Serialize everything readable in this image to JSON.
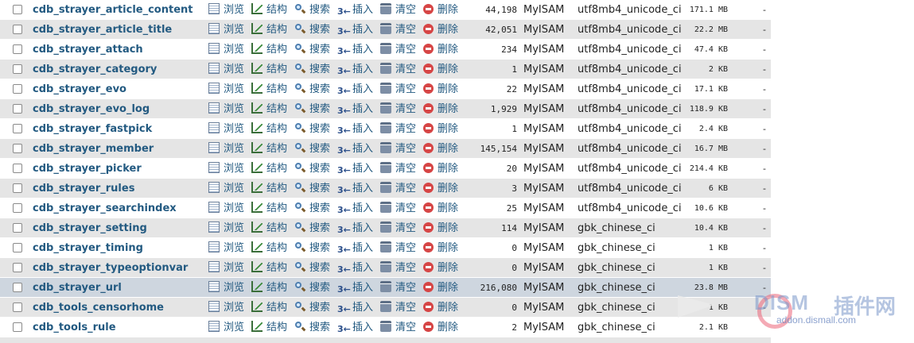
{
  "actions": {
    "browse": "浏览",
    "structure": "结构",
    "search": "搜索",
    "insert": "插入",
    "empty": "清空",
    "drop": "删除"
  },
  "overhead_default": "-",
  "tables": [
    {
      "name": "cdb_strayer_article_content",
      "rows": "44,198",
      "engine": "MyISAM",
      "collation": "utf8mb4_unicode_ci",
      "size": "171.1 MB",
      "overhead": "-"
    },
    {
      "name": "cdb_strayer_article_title",
      "rows": "42,051",
      "engine": "MyISAM",
      "collation": "utf8mb4_unicode_ci",
      "size": "22.2 MB",
      "overhead": "-"
    },
    {
      "name": "cdb_strayer_attach",
      "rows": "234",
      "engine": "MyISAM",
      "collation": "utf8mb4_unicode_ci",
      "size": "47.4 KB",
      "overhead": "-"
    },
    {
      "name": "cdb_strayer_category",
      "rows": "1",
      "engine": "MyISAM",
      "collation": "utf8mb4_unicode_ci",
      "size": "2 KB",
      "overhead": "-"
    },
    {
      "name": "cdb_strayer_evo",
      "rows": "22",
      "engine": "MyISAM",
      "collation": "utf8mb4_unicode_ci",
      "size": "17.1 KB",
      "overhead": "-"
    },
    {
      "name": "cdb_strayer_evo_log",
      "rows": "1,929",
      "engine": "MyISAM",
      "collation": "utf8mb4_unicode_ci",
      "size": "118.9 KB",
      "overhead": "-"
    },
    {
      "name": "cdb_strayer_fastpick",
      "rows": "1",
      "engine": "MyISAM",
      "collation": "utf8mb4_unicode_ci",
      "size": "2.4 KB",
      "overhead": "-"
    },
    {
      "name": "cdb_strayer_member",
      "rows": "145,154",
      "engine": "MyISAM",
      "collation": "utf8mb4_unicode_ci",
      "size": "16.7 MB",
      "overhead": "-"
    },
    {
      "name": "cdb_strayer_picker",
      "rows": "20",
      "engine": "MyISAM",
      "collation": "utf8mb4_unicode_ci",
      "size": "214.4 KB",
      "overhead": "-"
    },
    {
      "name": "cdb_strayer_rules",
      "rows": "3",
      "engine": "MyISAM",
      "collation": "utf8mb4_unicode_ci",
      "size": "6 KB",
      "overhead": "-"
    },
    {
      "name": "cdb_strayer_searchindex",
      "rows": "25",
      "engine": "MyISAM",
      "collation": "utf8mb4_unicode_ci",
      "size": "10.6 KB",
      "overhead": "-"
    },
    {
      "name": "cdb_strayer_setting",
      "rows": "114",
      "engine": "MyISAM",
      "collation": "gbk_chinese_ci",
      "size": "10.4 KB",
      "overhead": "-"
    },
    {
      "name": "cdb_strayer_timing",
      "rows": "0",
      "engine": "MyISAM",
      "collation": "gbk_chinese_ci",
      "size": "1 KB",
      "overhead": "-"
    },
    {
      "name": "cdb_strayer_typeoptionvar",
      "rows": "0",
      "engine": "MyISAM",
      "collation": "gbk_chinese_ci",
      "size": "1 KB",
      "overhead": "-"
    },
    {
      "name": "cdb_strayer_url",
      "rows": "216,080",
      "engine": "MyISAM",
      "collation": "gbk_chinese_ci",
      "size": "23.8 MB",
      "overhead": "-",
      "highlighted": true
    },
    {
      "name": "cdb_tools_censorhome",
      "rows": "0",
      "engine": "MyISAM",
      "collation": "gbk_chinese_ci",
      "size": "1 KB",
      "overhead": "-"
    },
    {
      "name": "cdb_tools_rule",
      "rows": "2",
      "engine": "MyISAM",
      "collation": "gbk_chinese_ci",
      "size": "2.1 KB",
      "overhead": ""
    }
  ],
  "watermark": {
    "logo": "DISM",
    "zh": "插件网",
    "url": "addon.dismall.com"
  },
  "colors": {
    "row_even": "#ffffff",
    "row_odd": "#e5e5e5",
    "row_highlight": "#ced6df",
    "link": "#235a81"
  }
}
